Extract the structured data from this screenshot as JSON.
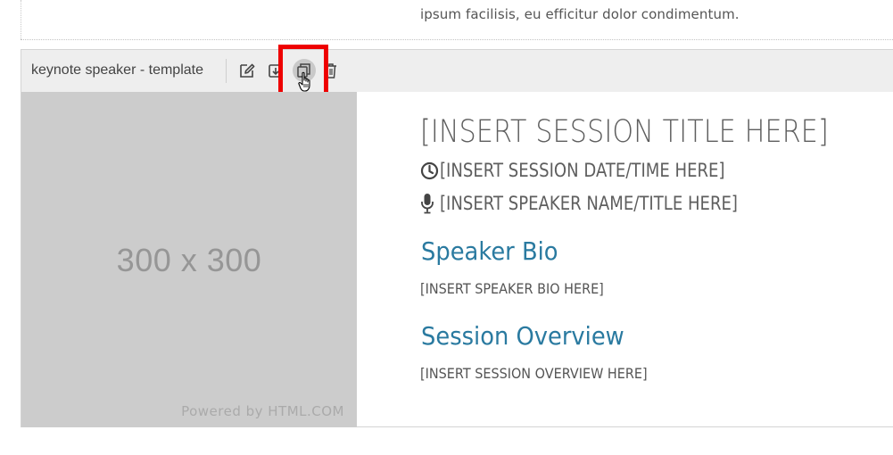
{
  "previous_block": {
    "text_tail": "ipsum facilisis, eu efficitur dolor condimentum."
  },
  "block": {
    "name": "keynote speaker - template",
    "toolbar": {
      "icons": [
        "edit-icon",
        "save-template-icon",
        "duplicate-icon",
        "delete-icon"
      ]
    }
  },
  "image": {
    "dimensions_label": "300 x 300",
    "powered_by": "Powered by HTML.COM"
  },
  "content": {
    "session_title": "[INSERT SESSION TITLE HERE]",
    "session_datetime": "[INSERT SESSION DATE/TIME HERE]",
    "speaker_name": "[INSERT SPEAKER NAME/TITLE HERE]",
    "bio_heading": "Speaker Bio",
    "bio_text": "[INSERT SPEAKER BIO HERE]",
    "overview_heading": "Session Overview",
    "overview_text": "[INSERT SESSION OVERVIEW HERE]"
  },
  "colors": {
    "heading_accent": "#2a7aa0",
    "highlight": "#ee0000",
    "placeholder_bg": "#cccccc",
    "toolbar_bg": "#eeeeee"
  }
}
